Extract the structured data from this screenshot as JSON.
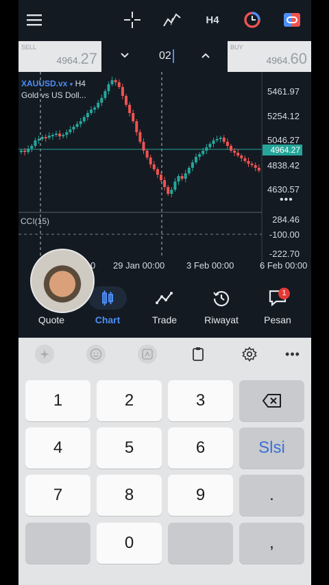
{
  "topbar": {
    "menu_icon": "hamburger-icon",
    "crosshair_icon": "crosshair-icon",
    "indicators_icon": "indicator-f-icon",
    "timeframe": "H4",
    "objects_icon": "objects-circle-icon",
    "trade_panel_icon": "one-click-trading-icon"
  },
  "price_row": {
    "sell_caption": "SELL",
    "sell_price_small": "4964.",
    "sell_price_big": "27",
    "buy_caption": "BUY",
    "buy_price_small": "4964.",
    "buy_price_big": "60",
    "lot_value": "02"
  },
  "chart": {
    "symbol": "XAUUSD.vx",
    "timeframe": "H4",
    "description": "Gold vs US Doll...",
    "y_labels": [
      "5461.97",
      "5254.12",
      "5046.27",
      "4838.42",
      "4630.57"
    ],
    "current_price": "4964.27",
    "cci_label": "CCI(15)",
    "cci_labels": [
      "284.46",
      "-100.00",
      "-222.70"
    ],
    "x_labels": [
      "0",
      "29 Jan 00:00",
      "3 Feb 00:00",
      "6 Feb 00:00"
    ],
    "colors": {
      "bull": "#26a69a",
      "bear": "#ef5350",
      "current": "#26a69a"
    }
  },
  "nav": {
    "items": [
      {
        "label": "Quote",
        "icon": "quote-icon"
      },
      {
        "label": "Chart",
        "icon": "chart-icon"
      },
      {
        "label": "Trade",
        "icon": "trade-icon"
      },
      {
        "label": "Riwayat",
        "icon": "history-icon"
      },
      {
        "label": "Pesan",
        "icon": "message-icon",
        "badge": "1"
      }
    ],
    "active": "Chart",
    "accent": "#4d8ef7"
  },
  "keyboard": {
    "toolbar": [
      "sparkle-icon",
      "emoji-icon",
      "sticker-icon",
      "clipboard-icon",
      "settings-icon",
      "more-icon"
    ],
    "keys": [
      "1",
      "2",
      "3",
      "4",
      "5",
      "6",
      "Slsi",
      "7",
      "8",
      "9",
      ".",
      "0",
      ","
    ],
    "done_label": "Slsi"
  }
}
